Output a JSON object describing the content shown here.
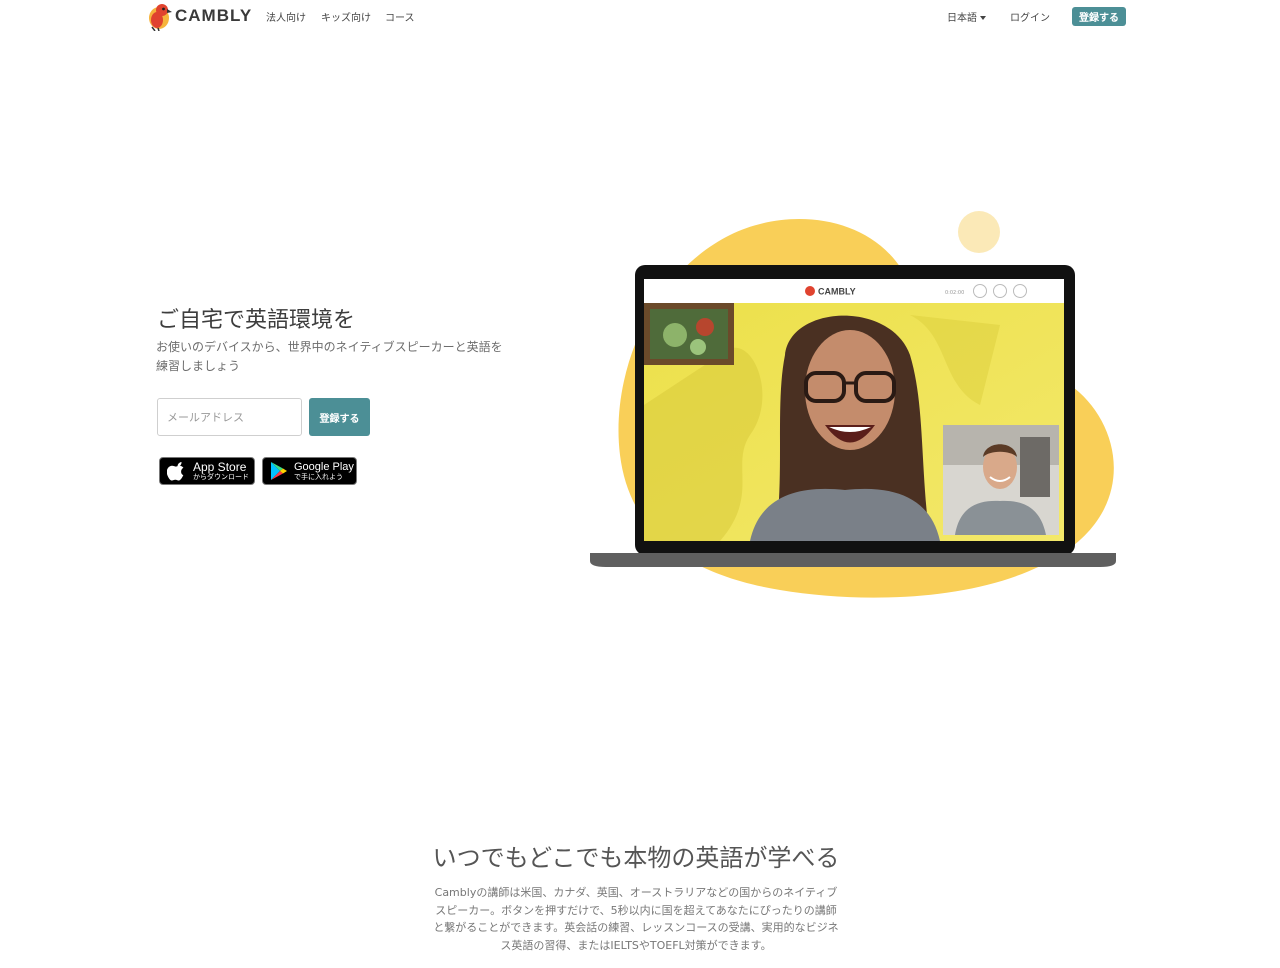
{
  "nav": {
    "logo_text": "CAMBLY",
    "links": [
      "法人向け",
      "キッズ向け",
      "コース"
    ],
    "language": "日本語",
    "login": "ログイン",
    "signup": "登録する"
  },
  "hero": {
    "title": "ご自宅で英語環境を",
    "subtitle": "お使いのデバイスから、世界中のネイティブスピーカーと英語を練習しましょう",
    "email_placeholder": "メールアドレス",
    "signup_button": "登録する",
    "app_store": {
      "title": "App Store",
      "subtitle": "からダウンロード"
    },
    "google_play": {
      "title": "Google Play",
      "subtitle": "で手に入れよう"
    }
  },
  "video_ui": {
    "logo_text": "CAMBLY",
    "timer": "0:02:00",
    "controls": [
      "camera-icon",
      "speaker-icon",
      "microphone-icon"
    ]
  },
  "section2": {
    "title": "いつでもどこでも本物の英語が学べる",
    "body": "Camblyの講師は米国、カナダ、英国、オーストラリアなどの国からのネイティブスピーカー。ボタンを押すだけで、5秒以内に国を超えてあなたにぴったりの講師と繋がることができます。英会話の練習、レッスンコースの受講、実用的なビジネス英語の習得、またはIELTSやTOEFL対策ができます。"
  },
  "colors": {
    "accent": "#4c8f96",
    "blob": "#f9cf58",
    "blob_light": "#fbe9b7",
    "laptop_body": "#5f5f5f"
  }
}
